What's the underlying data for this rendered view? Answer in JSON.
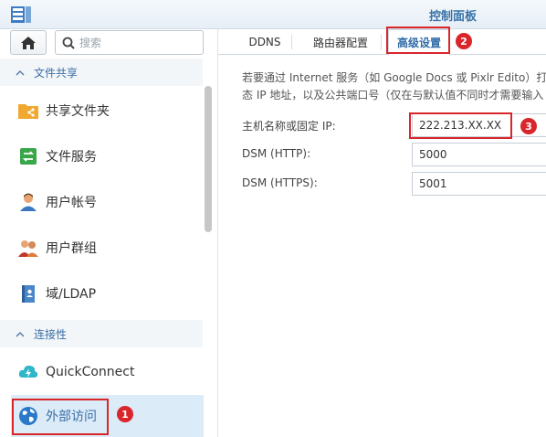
{
  "window": {
    "title": "控制面板"
  },
  "sidebar": {
    "search_placeholder": "搜索",
    "sections": [
      {
        "label": "文件共享",
        "items": [
          {
            "label": "共享文件夹",
            "icon": "shared-folder-icon"
          },
          {
            "label": "文件服务",
            "icon": "file-services-icon"
          },
          {
            "label": "用户帐号",
            "icon": "user-icon"
          },
          {
            "label": "用户群组",
            "icon": "group-icon"
          },
          {
            "label": "域/LDAP",
            "icon": "ldap-icon"
          }
        ]
      },
      {
        "label": "连接性",
        "items": [
          {
            "label": "QuickConnect",
            "icon": "quickconnect-icon"
          },
          {
            "label": "外部访问",
            "icon": "globe-icon",
            "active": true
          }
        ]
      }
    ]
  },
  "tabs": [
    {
      "label": "DDNS"
    },
    {
      "label": "路由器配置"
    },
    {
      "label": "高级设置",
      "active": true
    }
  ],
  "main": {
    "description_line1": "若要通过 Internet 服务（如 Google Docs 或 Pixlr Edito）打",
    "description_line2": "态 IP 地址，以及公共端口号（仅在与默认值不同时才需要输入",
    "fields": [
      {
        "label": "主机名称或固定 IP:",
        "value": "222.213.XX.XX"
      },
      {
        "label": "DSM (HTTP):",
        "value": "5000"
      },
      {
        "label": "DSM (HTTPS):",
        "value": "5001"
      }
    ]
  },
  "annotations": [
    "1",
    "2",
    "3"
  ],
  "colors": {
    "accent": "#3a6ea5",
    "highlight": "#d9262b",
    "active_bg": "#dcebf8"
  }
}
